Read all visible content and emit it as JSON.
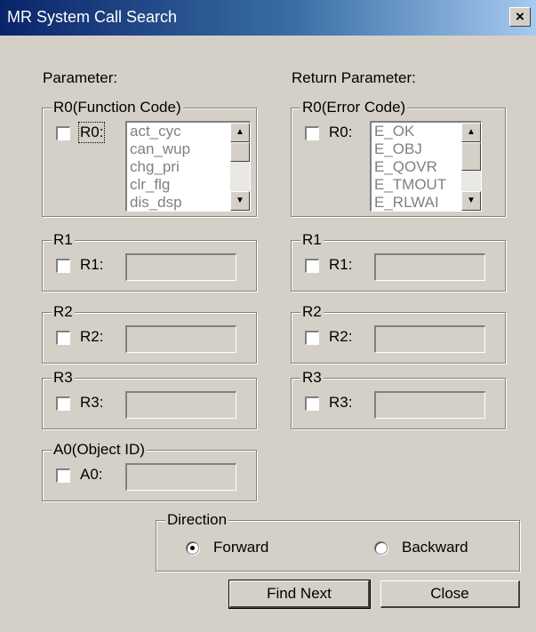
{
  "window": {
    "title": "MR System Call Search",
    "close_glyph": "×"
  },
  "parameter": {
    "heading": "Parameter:",
    "r0": {
      "group_label": "R0(Function Code)",
      "checkbox_label": "R0:",
      "list": [
        "act_cyc",
        "can_wup",
        "chg_pri",
        "clr_flg",
        "dis_dsp"
      ]
    },
    "r1": {
      "group_label": "R1",
      "checkbox_label": "R1:",
      "value": ""
    },
    "r2": {
      "group_label": "R2",
      "checkbox_label": "R2:",
      "value": ""
    },
    "r3": {
      "group_label": "R3",
      "checkbox_label": "R3:",
      "value": ""
    },
    "a0": {
      "group_label": "A0(Object ID)",
      "checkbox_label": "A0:",
      "value": ""
    }
  },
  "return_parameter": {
    "heading": "Return Parameter:",
    "r0": {
      "group_label": "R0(Error Code)",
      "checkbox_label": "R0:",
      "list": [
        "E_OK",
        "E_OBJ",
        "E_QOVR",
        "E_TMOUT",
        "E_RLWAI"
      ]
    },
    "r1": {
      "group_label": "R1",
      "checkbox_label": "R1:",
      "value": ""
    },
    "r2": {
      "group_label": "R2",
      "checkbox_label": "R2:",
      "value": ""
    },
    "r3": {
      "group_label": "R3",
      "checkbox_label": "R3:",
      "value": ""
    }
  },
  "direction": {
    "group_label": "Direction",
    "forward_label": "Forward",
    "backward_label": "Backward",
    "selected": "Forward"
  },
  "buttons": {
    "find_next": "Find Next",
    "close": "Close"
  }
}
